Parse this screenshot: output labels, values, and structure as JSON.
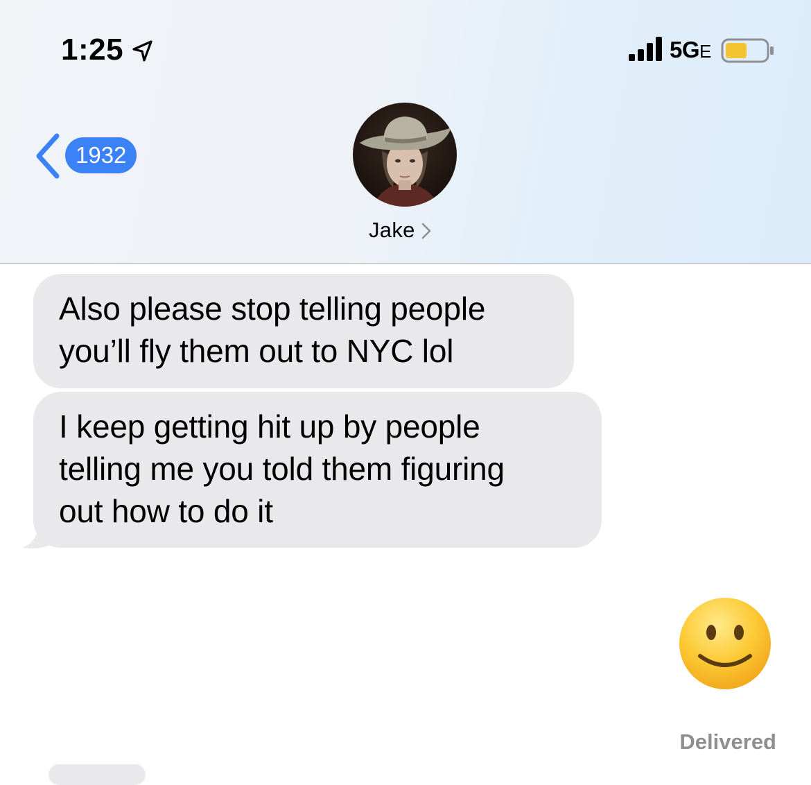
{
  "status_bar": {
    "time": "1:25",
    "network": "5G",
    "network_suffix": "E",
    "battery_color": "#f4c430",
    "icons": [
      "location-arrow-icon",
      "signal-bars-icon",
      "battery-icon"
    ]
  },
  "nav": {
    "back_badge": "1932",
    "back_icon": "chevron-left-icon",
    "contact_name": "Jake",
    "contact_chevron_icon": "chevron-right-icon",
    "accent_color": "#3a82f6"
  },
  "messages": [
    {
      "direction": "incoming",
      "text": "Also please stop telling people\nyou’ll fly them out to NYC lol"
    },
    {
      "direction": "incoming",
      "text": "I keep getting hit up by people\ntelling me you told them figuring\nout how to do it"
    },
    {
      "direction": "outgoing",
      "type": "emoji",
      "emoji": "slightly-smiling-face"
    }
  ],
  "delivery_status": "Delivered"
}
